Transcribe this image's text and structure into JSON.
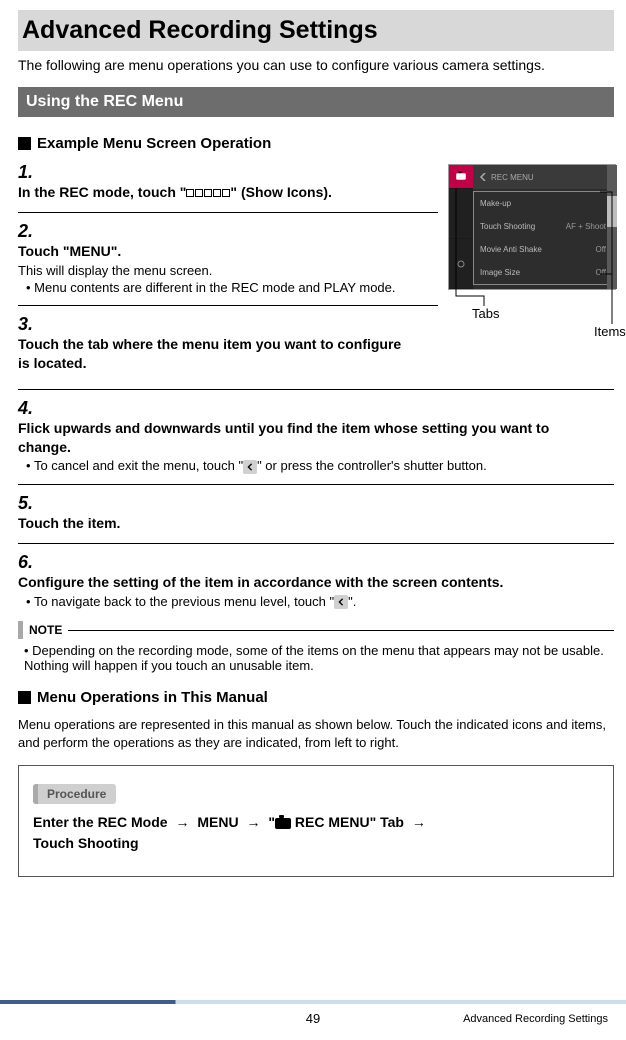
{
  "title": "Advanced Recording Settings",
  "intro": "The following are menu operations you can use to configure various camera settings.",
  "section": "Using the REC Menu",
  "subheading1": "Example Menu Screen Operation",
  "steps": {
    "s1": {
      "text_a": "In the REC mode, touch \"",
      "text_b": "\" (Show Icons)."
    },
    "s2": {
      "text": "Touch \"MENU\".",
      "detail": "This will display the menu screen.",
      "bullet": "Menu contents are different in the REC mode and PLAY mode."
    },
    "s3": {
      "text": "Touch the tab where the menu item you want to configure is located."
    },
    "s4": {
      "text": "Flick upwards and downwards until you find the item whose setting you want to change.",
      "bullet_a": "To cancel and exit the menu, touch \"",
      "bullet_b": "\" or press the controller's shutter button."
    },
    "s5": {
      "text": "Touch the item."
    },
    "s6": {
      "text": "Configure the setting of the item in accordance with the screen contents.",
      "bullet_a": "To navigate back to the previous menu level, touch \"",
      "bullet_b": "\"."
    }
  },
  "figure": {
    "header": "REC MENU",
    "rows": [
      {
        "label": "Make-up",
        "value": ""
      },
      {
        "label": "Touch Shooting",
        "value": "AF + Shoot"
      },
      {
        "label": "Movie Anti Shake",
        "value": "Off"
      },
      {
        "label": "Image Size",
        "value": "Off"
      }
    ],
    "tabs_label": "Tabs",
    "items_label": "Items"
  },
  "note_label": "NOTE",
  "note_text": "Depending on the recording mode, some of the items on the menu that appears may not be usable. Nothing will happen if you touch an unusable item.",
  "subheading2": "Menu Operations in This Manual",
  "menuops_text": "Menu operations are represented in this manual as shown below. Touch the indicated icons and items, and perform the operations as they are indicated, from left to right.",
  "procedure_label": "Procedure",
  "procedure_parts": {
    "a": "Enter the REC Mode",
    "b": "MENU",
    "c_a": "\"",
    "c_b": " REC MENU\" Tab",
    "d": "Touch Shooting"
  },
  "footer": {
    "page": "49",
    "chapter": "Advanced Recording Settings"
  }
}
